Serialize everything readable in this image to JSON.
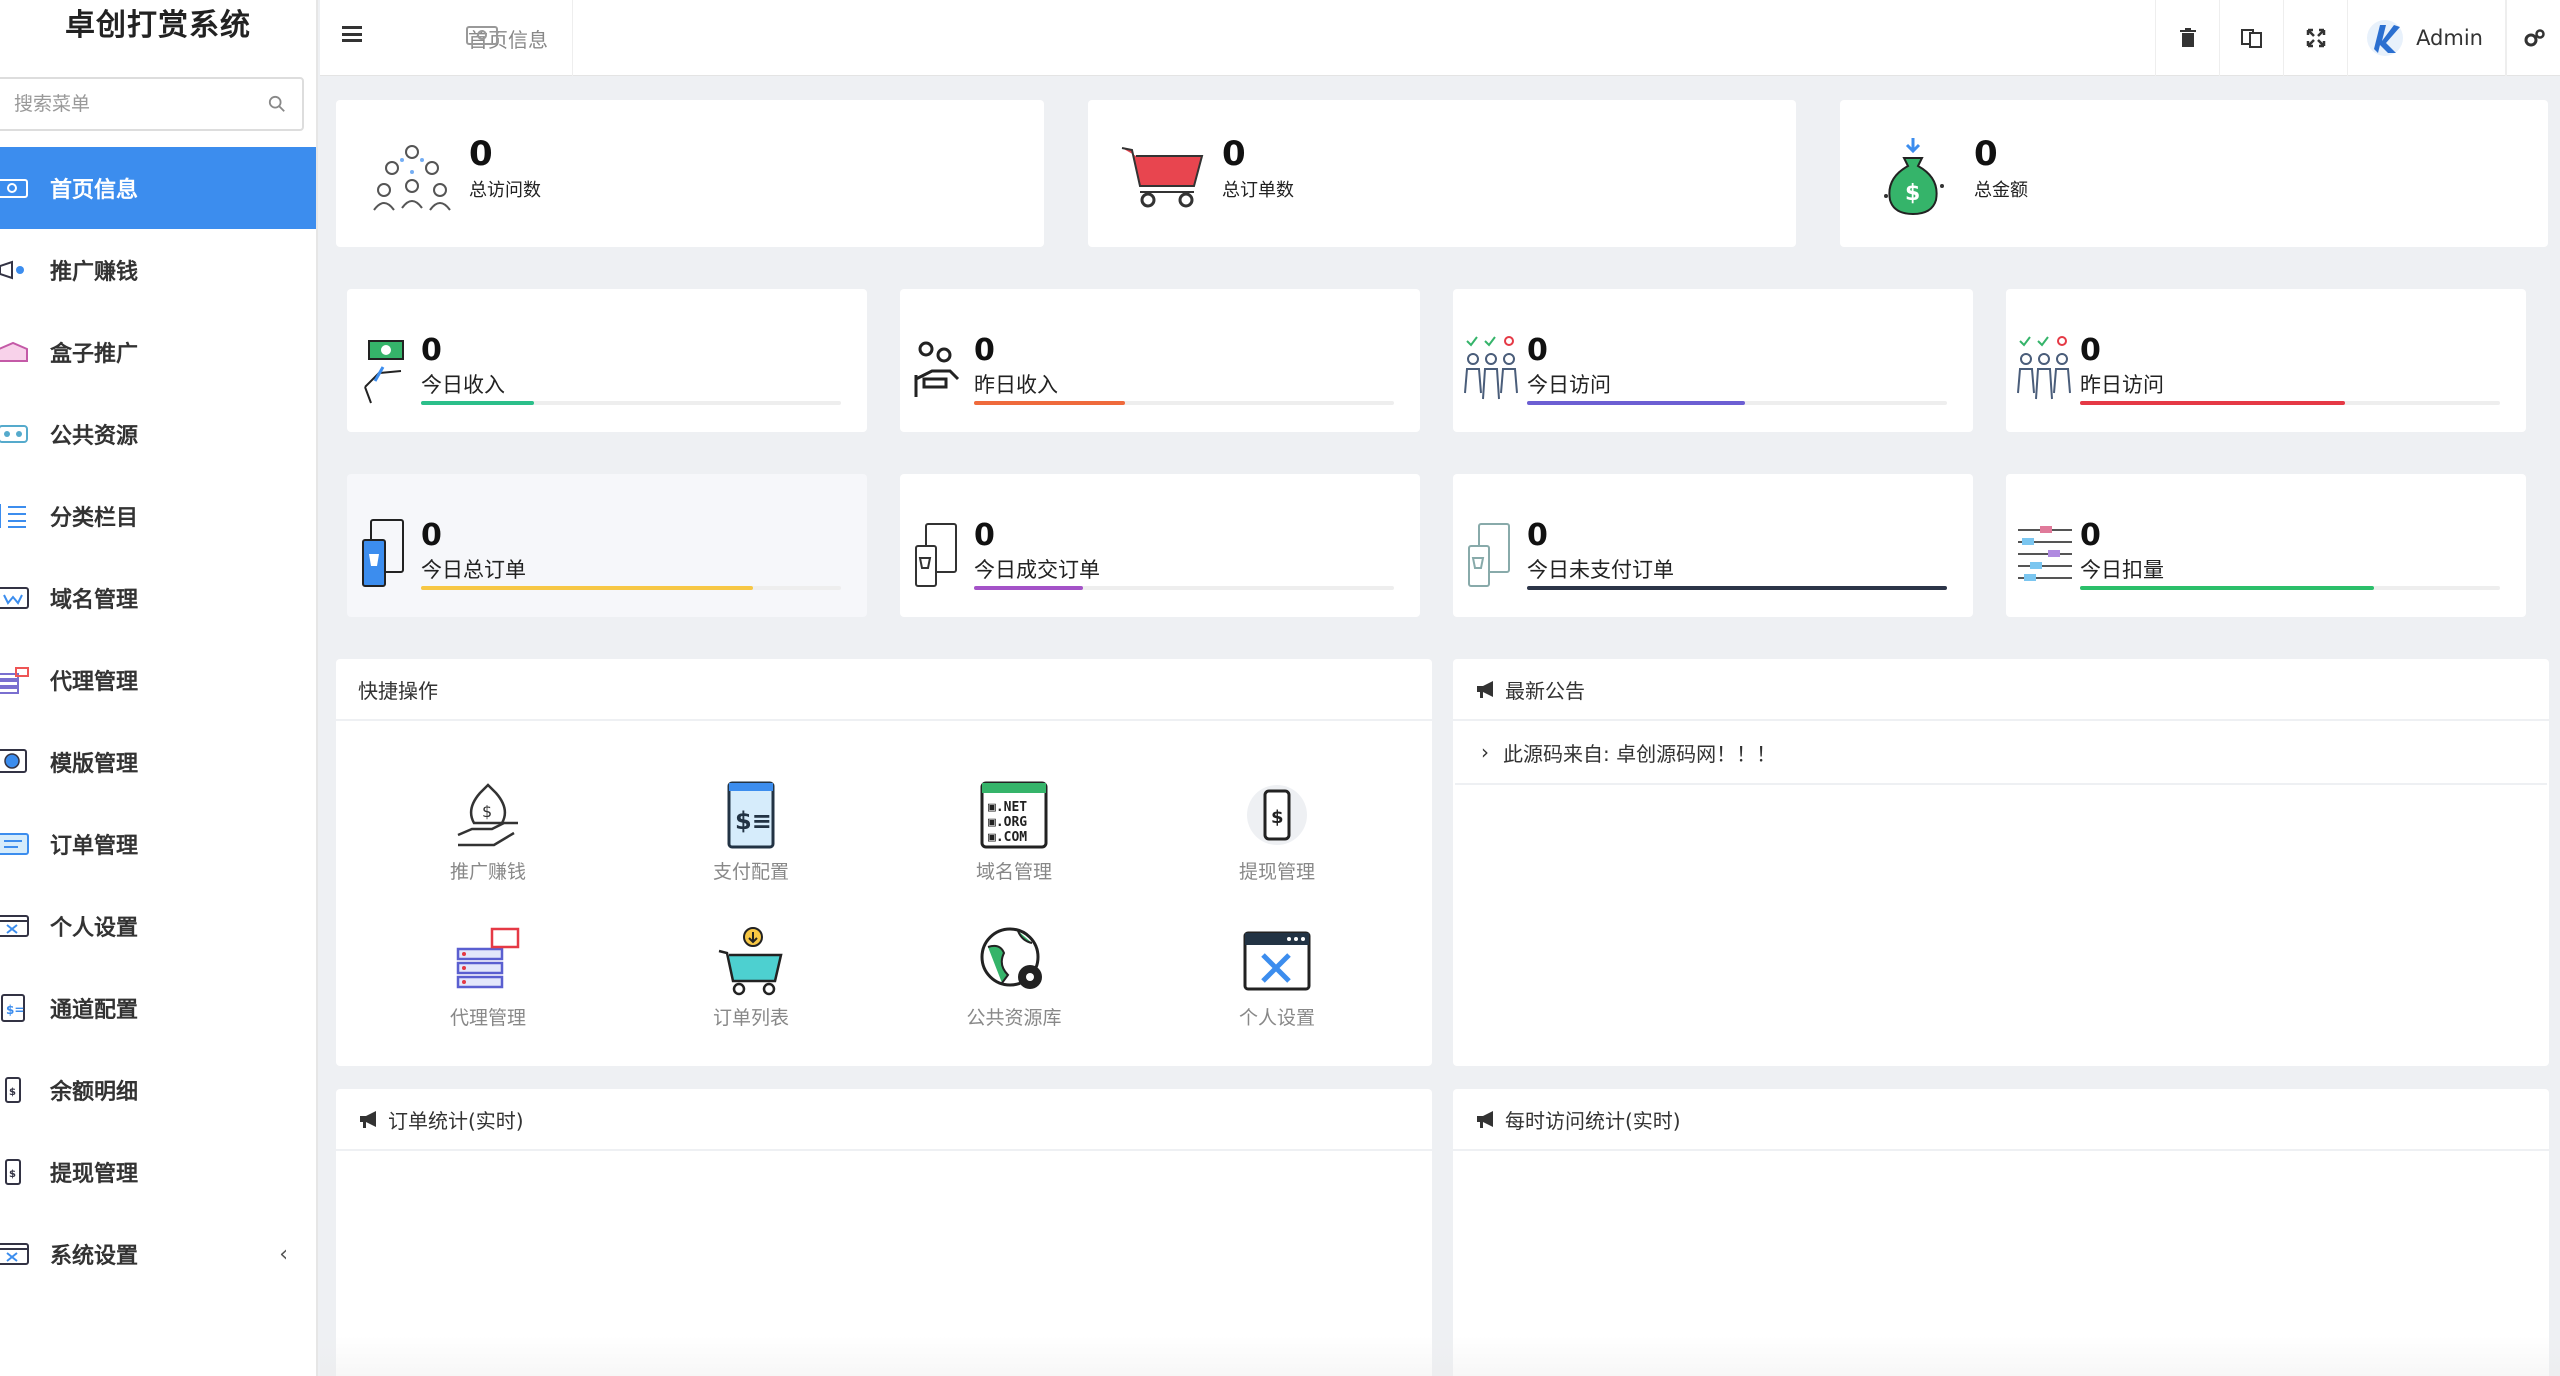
{
  "app": {
    "title": "卓创打赏系统"
  },
  "search": {
    "placeholder": "搜索菜单"
  },
  "sidebar": {
    "items": [
      {
        "label": "首页信息"
      },
      {
        "label": "推广赚钱"
      },
      {
        "label": "盒子推广"
      },
      {
        "label": "公共资源"
      },
      {
        "label": "分类栏目"
      },
      {
        "label": "域名管理"
      },
      {
        "label": "代理管理"
      },
      {
        "label": "模版管理"
      },
      {
        "label": "订单管理"
      },
      {
        "label": "个人设置"
      },
      {
        "label": "通道配置"
      },
      {
        "label": "余额明细"
      },
      {
        "label": "提现管理"
      },
      {
        "label": "系统设置"
      }
    ],
    "expand_arrow": "‹"
  },
  "topbar": {
    "tab_label": "首页信息",
    "user": "Admin"
  },
  "stats_top": [
    {
      "value": "0",
      "label": "总访问数"
    },
    {
      "value": "0",
      "label": "总订单数"
    },
    {
      "value": "0",
      "label": "总金额"
    }
  ],
  "stats_row1": [
    {
      "value": "0",
      "label": "今日收入",
      "bar_color": "#2bbf8a",
      "progress": 0.27
    },
    {
      "value": "0",
      "label": "昨日收入",
      "bar_color": "#ef6a3c",
      "progress": 0.36
    },
    {
      "value": "0",
      "label": "今日访问",
      "bar_color": "#6c5fd3",
      "progress": 0.52
    },
    {
      "value": "0",
      "label": "昨日访问",
      "bar_color": "#e53945",
      "progress": 0.63
    }
  ],
  "stats_row2": [
    {
      "value": "0",
      "label": "今日总订单",
      "bar_color": "#f7c744",
      "progress": 0.79
    },
    {
      "value": "0",
      "label": "今日成交订单",
      "bar_color": "#a452c8",
      "progress": 0.26
    },
    {
      "value": "0",
      "label": "今日未支付订单",
      "bar_color": "#2c3548",
      "progress": 1.0
    },
    {
      "value": "0",
      "label": "今日扣量",
      "bar_color": "#2bbf6a",
      "progress": 0.7
    }
  ],
  "quick": {
    "title": "快捷操作",
    "items": [
      {
        "label": "推广赚钱",
        "icon": "money-bag-hand-icon"
      },
      {
        "label": "支付配置",
        "icon": "invoice-icon"
      },
      {
        "label": "域名管理",
        "icon": "domain-icon"
      },
      {
        "label": "提现管理",
        "icon": "phone-dollar-icon"
      },
      {
        "label": "代理管理",
        "icon": "server-icon"
      },
      {
        "label": "订单列表",
        "icon": "cart-icon"
      },
      {
        "label": "公共资源库",
        "icon": "globe-gear-icon"
      },
      {
        "label": "个人设置",
        "icon": "window-tools-icon"
      }
    ]
  },
  "announce": {
    "title": "最新公告",
    "items": [
      {
        "text": "此源码来自: 卓创源码网！！！"
      }
    ]
  },
  "order_stats": {
    "title": "订单统计(实时)"
  },
  "visit_stats": {
    "title": "每时访问统计(实时)"
  },
  "colors": {
    "accent": "#3c8dee"
  }
}
